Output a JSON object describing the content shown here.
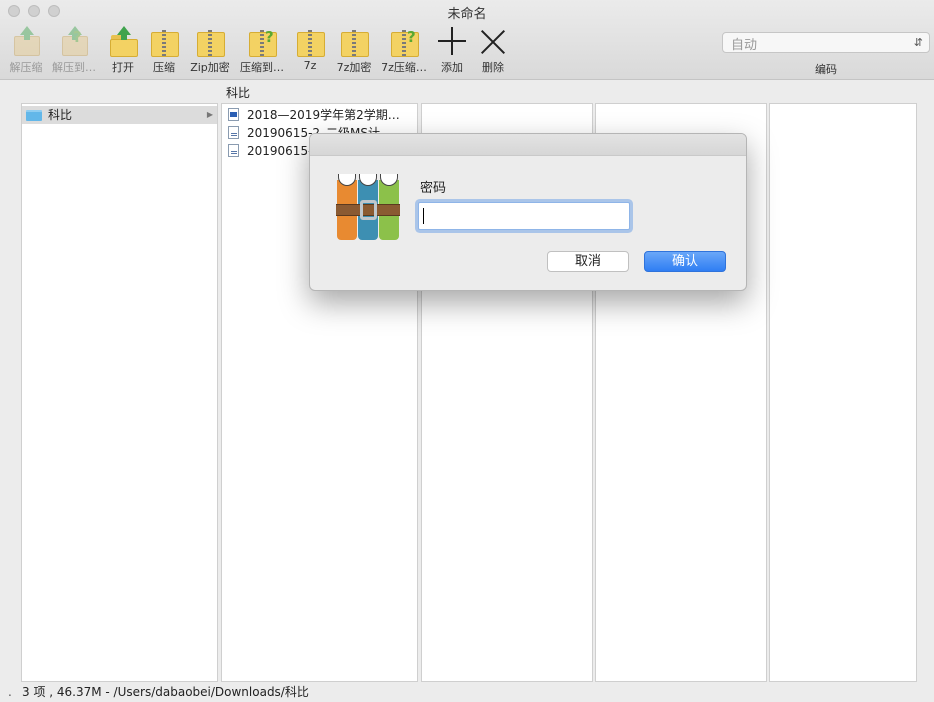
{
  "window": {
    "title": "未命名"
  },
  "toolbar": {
    "items": [
      {
        "id": "extract",
        "label": "解压缩",
        "icon": "extract-box-icon",
        "enabled": false
      },
      {
        "id": "extract_to",
        "label": "解压到…",
        "icon": "extract-to-box-icon",
        "enabled": false
      },
      {
        "id": "open",
        "label": "打开",
        "icon": "open-folder-icon",
        "enabled": true
      },
      {
        "id": "compress",
        "label": "压缩",
        "icon": "compress-zip-icon",
        "enabled": true
      },
      {
        "id": "zip_encrypt",
        "label": "Zip加密",
        "icon": "zip-encrypt-icon",
        "enabled": true
      },
      {
        "id": "compress_to",
        "label": "压缩到…",
        "icon": "compress-to-icon",
        "enabled": true
      },
      {
        "id": "7z",
        "label": "7z",
        "icon": "7z-zip-icon",
        "enabled": true
      },
      {
        "id": "7z_encrypt",
        "label": "7z加密",
        "icon": "7z-encrypt-icon",
        "enabled": true
      },
      {
        "id": "7z_compress",
        "label": "7z压缩…",
        "icon": "7z-compress-icon",
        "enabled": true
      },
      {
        "id": "add",
        "label": "添加",
        "icon": "plus-icon",
        "enabled": true
      },
      {
        "id": "delete",
        "label": "删除",
        "icon": "x-icon",
        "enabled": true
      }
    ],
    "encoding": {
      "selected": "自动",
      "label": "编码"
    }
  },
  "browser": {
    "path_label": "科比",
    "col1": [
      {
        "name": "科比",
        "type": "folder",
        "selected": true
      }
    ],
    "col2": [
      {
        "name": "2018—2019学年第2学期…",
        "type": "word"
      },
      {
        "name": "20190615-2_二级MS计…",
        "type": "txt"
      },
      {
        "name": "20190615-",
        "type": "txt"
      }
    ]
  },
  "dialog": {
    "label": "密码",
    "value": "",
    "cancel_label": "取消",
    "ok_label": "确认",
    "icon": "archive-app-icon"
  },
  "status": {
    "dot": ".",
    "text": "3 项 , 46.37M - /Users/dabaobei/Downloads/科比"
  },
  "colors": {
    "accent": "#2f7ef3",
    "folder_blue": "#62b7e9",
    "selection": "#dcdcdc"
  }
}
